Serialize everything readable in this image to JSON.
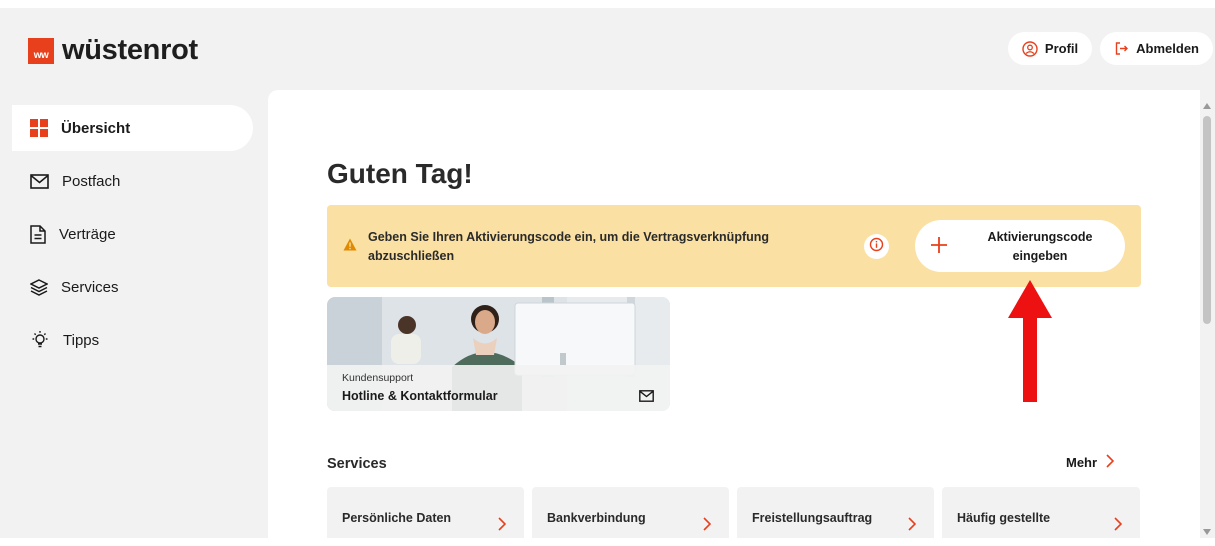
{
  "brand": {
    "mark": "ww",
    "name": "wüstenrot",
    "accent": "#e8401c"
  },
  "header": {
    "profile_label": "Profil",
    "logout_label": "Abmelden"
  },
  "sidebar": {
    "items": [
      {
        "label": "Übersicht",
        "icon": "grid-icon",
        "active": true
      },
      {
        "label": "Postfach",
        "icon": "mail-icon",
        "active": false
      },
      {
        "label": "Verträge",
        "icon": "document-icon",
        "active": false
      },
      {
        "label": "Services",
        "icon": "layers-icon",
        "active": false
      },
      {
        "label": "Tipps",
        "icon": "lightbulb-icon",
        "active": false
      }
    ]
  },
  "main": {
    "greeting": "Guten Tag!",
    "banner": {
      "text": "Geben Sie Ihren Aktivierungscode ein, um die Vertragsverknüpfung abzuschließen",
      "button_line1": "Aktivierungscode",
      "button_line2": "eingeben",
      "background": "#fae0a2"
    },
    "support_card": {
      "small_label": "Kundensupport",
      "title": "Hotline & Kontaktformular"
    },
    "services": {
      "heading": "Services",
      "more_label": "Mehr",
      "cards": [
        {
          "title": "Persönliche Daten"
        },
        {
          "title": "Bankverbindung"
        },
        {
          "title": "Freistellungsauftrag"
        },
        {
          "title": "Häufig gestellte"
        }
      ]
    }
  }
}
